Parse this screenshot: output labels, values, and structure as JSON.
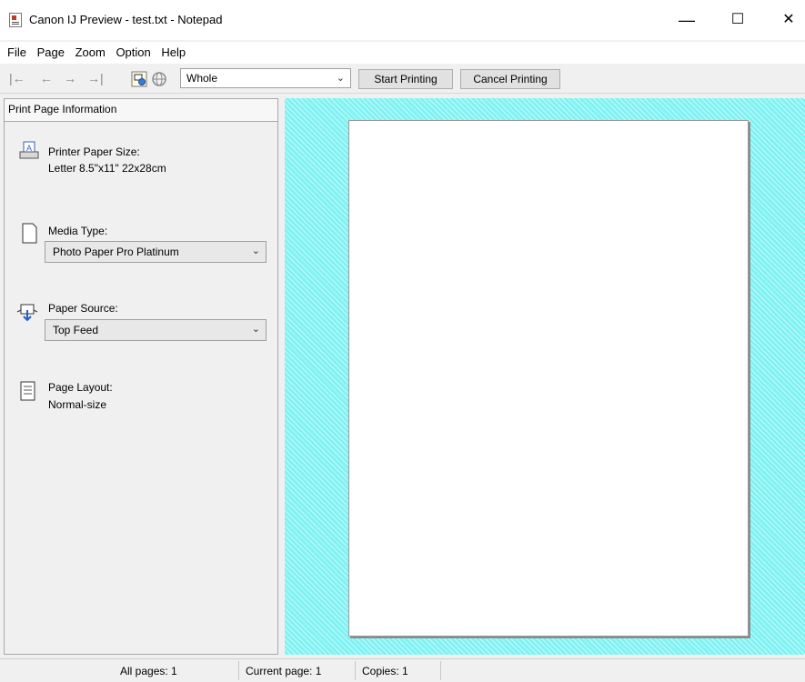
{
  "window": {
    "title": "Canon IJ Preview - test.txt - Notepad"
  },
  "window_controls": {
    "minimize": "—",
    "maximize": "☐",
    "close": "✕"
  },
  "menu": [
    "File",
    "Page",
    "Zoom",
    "Option",
    "Help"
  ],
  "toolbar": {
    "nav": [
      "|←",
      "←",
      "→",
      "→|"
    ],
    "zoom_value": "Whole",
    "start_printing": "Start Printing",
    "cancel_printing": "Cancel Printing",
    "icons": [
      "printer-settings-icon",
      "globe-icon"
    ]
  },
  "panel": {
    "header": "Print Page Information",
    "printer_paper_size": {
      "label": "Printer Paper Size:",
      "value": "Letter 8.5\"x11\" 22x28cm",
      "icon": "printer-paper-icon"
    },
    "media_type": {
      "label": "Media Type:",
      "value": "Photo Paper Pro Platinum",
      "icon": "media-sheet-icon"
    },
    "paper_source": {
      "label": "Paper Source:",
      "value": "Top Feed",
      "icon": "paper-source-icon"
    },
    "page_layout": {
      "label": "Page Layout:",
      "value": "Normal-size",
      "icon": "page-layout-icon"
    }
  },
  "status": {
    "all_pages": "All pages:  1",
    "current_page": "Current page:  1",
    "copies": "Copies:  1"
  },
  "colors": {
    "preview_background": "#80f2f2",
    "page": "#ffffff"
  }
}
